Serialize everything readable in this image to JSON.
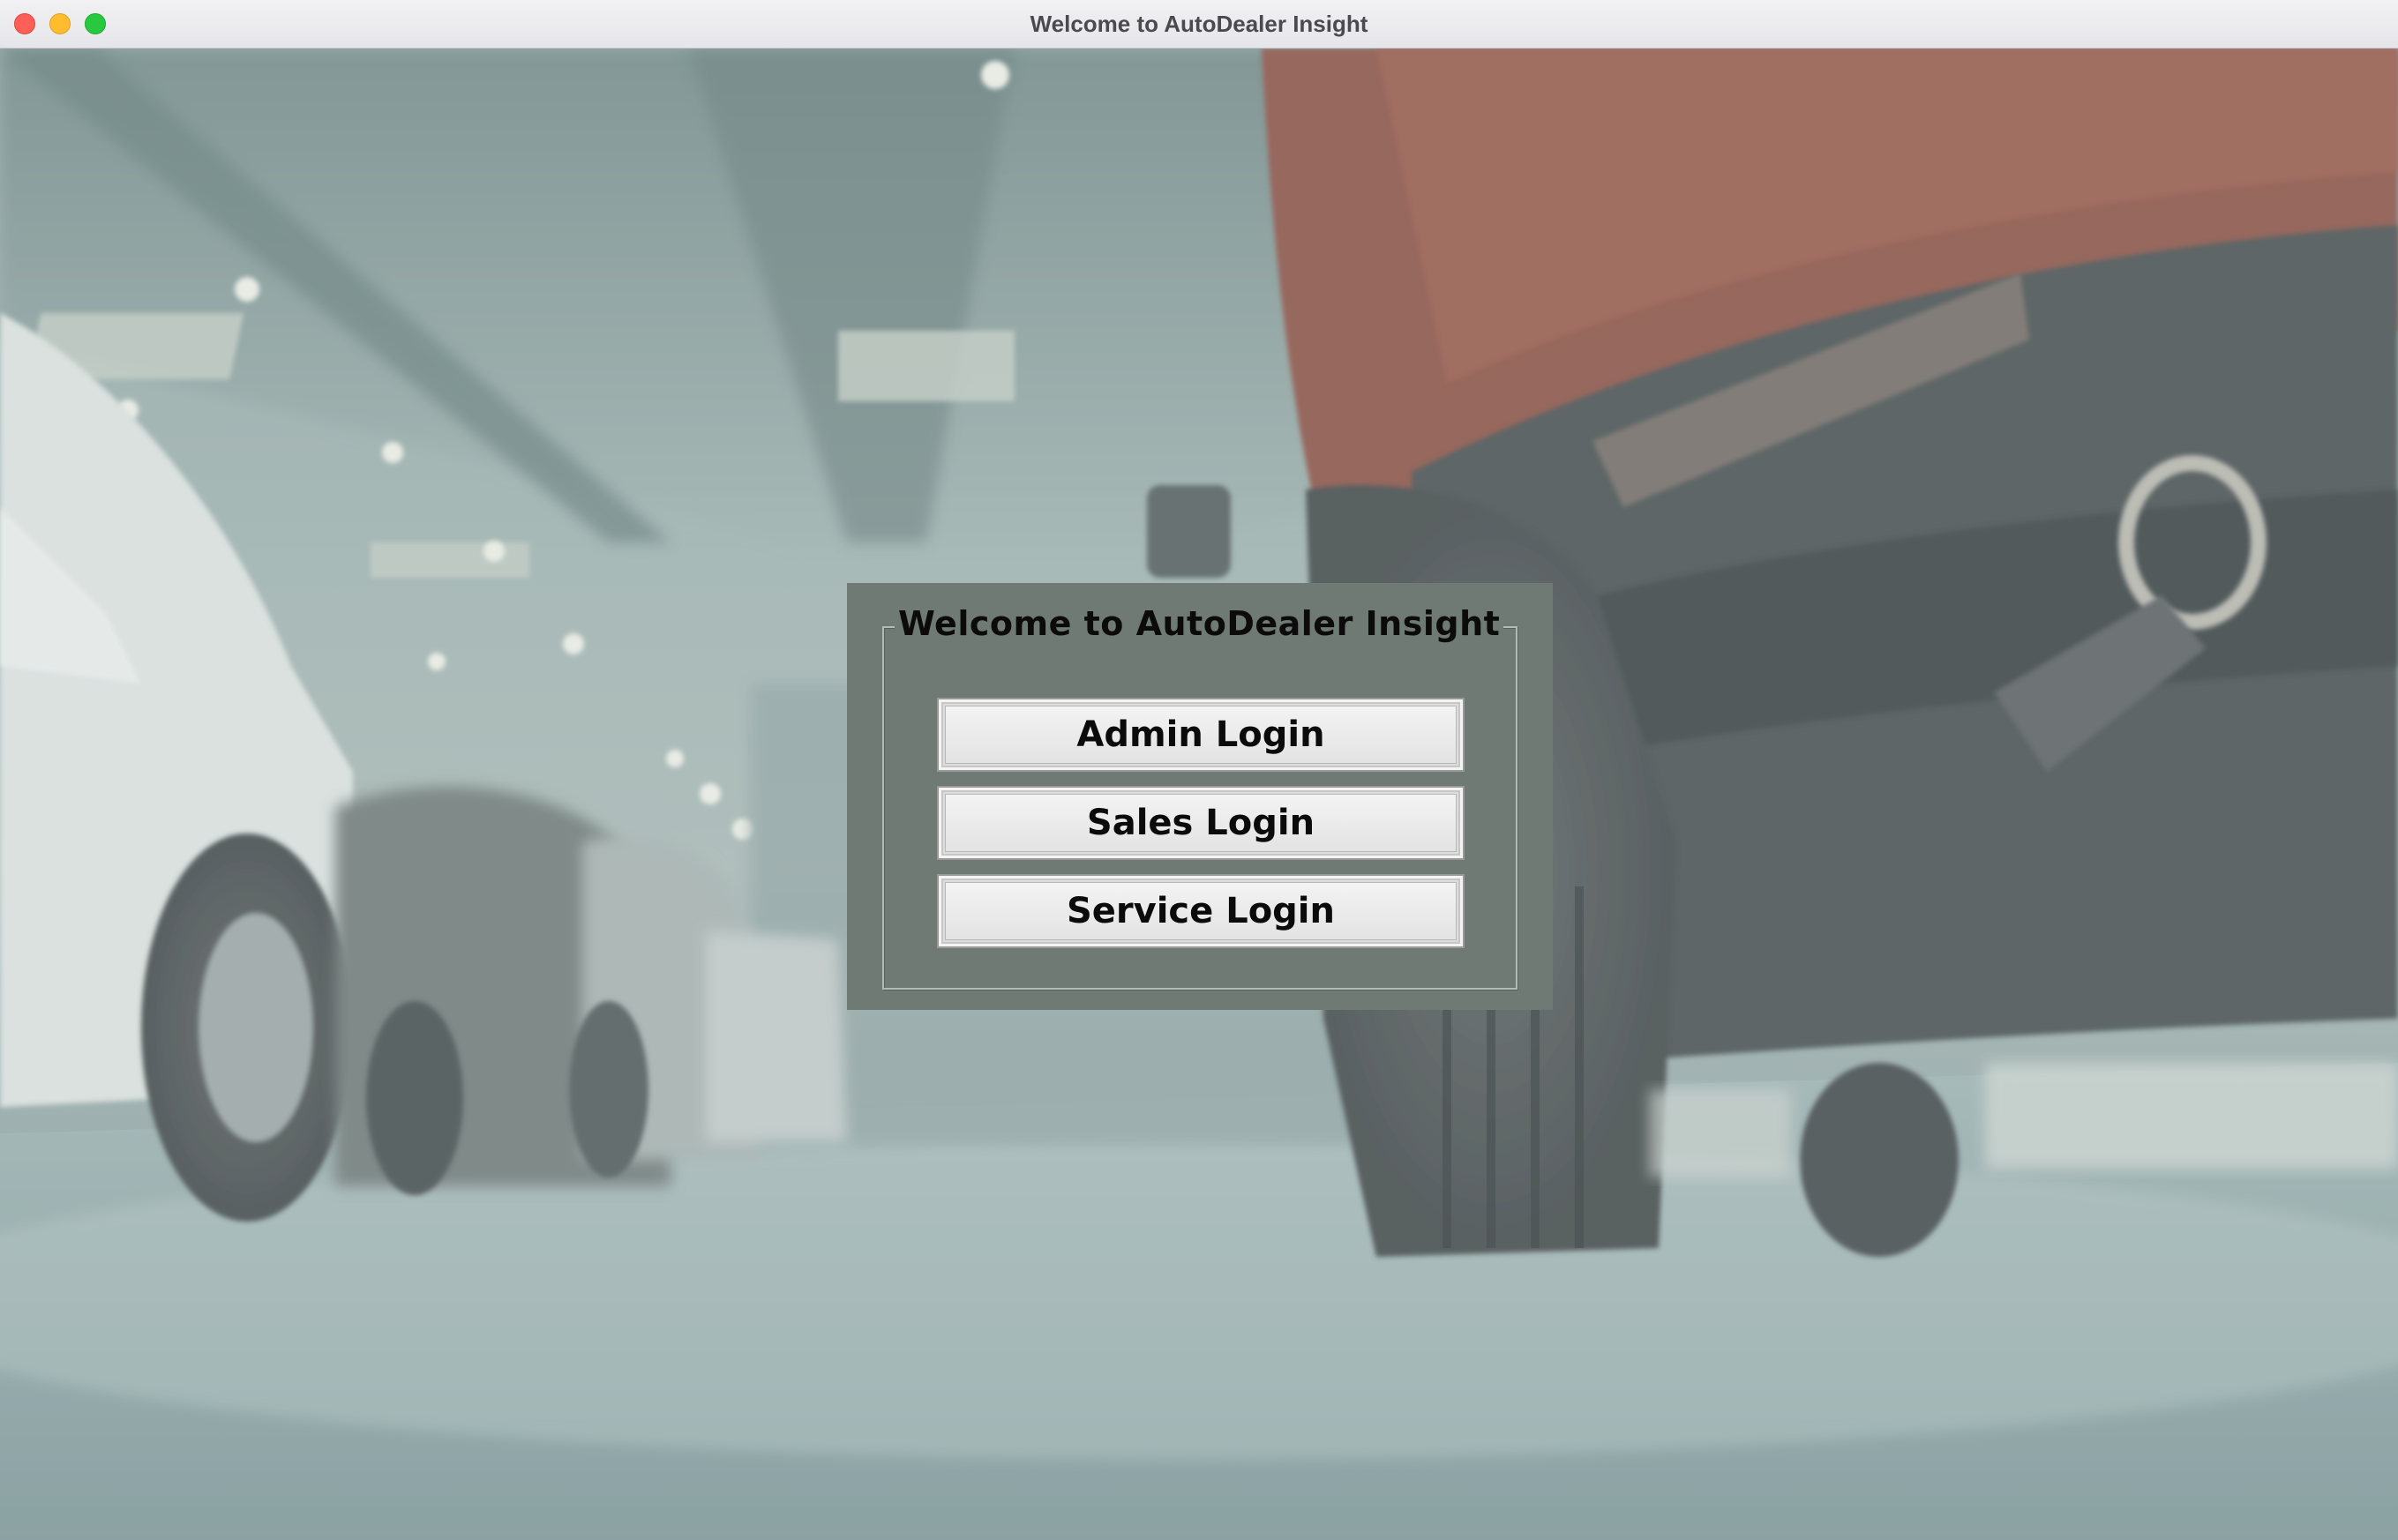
{
  "window": {
    "title": "Welcome to AutoDealer Insight"
  },
  "panel": {
    "group_title": "Welcome to AutoDealer Insight",
    "buttons": [
      {
        "label": "Admin Login"
      },
      {
        "label": "Sales Login"
      },
      {
        "label": "Service Login"
      }
    ]
  },
  "colors": {
    "panel_bg": "#6f7a74",
    "button_bg": "#e6e6e6",
    "close": "#fe5f57",
    "minimize": "#febc2e",
    "maximize": "#28c840"
  },
  "background": {
    "image": "car-showroom-photo"
  }
}
